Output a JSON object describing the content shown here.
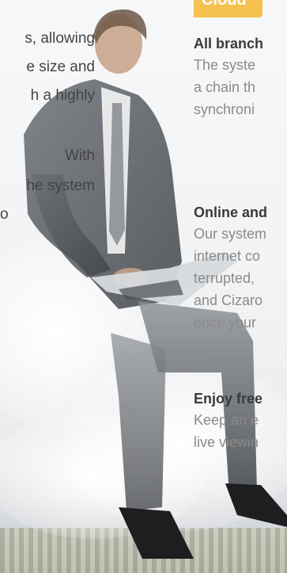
{
  "left_col": {
    "lines": [
      "s, allowing",
      "e size and",
      "h a highly",
      "With",
      "he system",
      "o"
    ]
  },
  "right_col": {
    "badge": "Cloud",
    "blocks": [
      {
        "heading": "All branch",
        "lines": [
          "The syste",
          "a chain th",
          "synchroni"
        ]
      },
      {
        "heading": "Online and",
        "lines": [
          "Our system",
          "internet co",
          "terrupted,",
          "and Cizaro",
          "once your"
        ]
      },
      {
        "heading": "Enjoy free",
        "lines": [
          "Keep an e",
          "live viewin"
        ]
      }
    ]
  }
}
